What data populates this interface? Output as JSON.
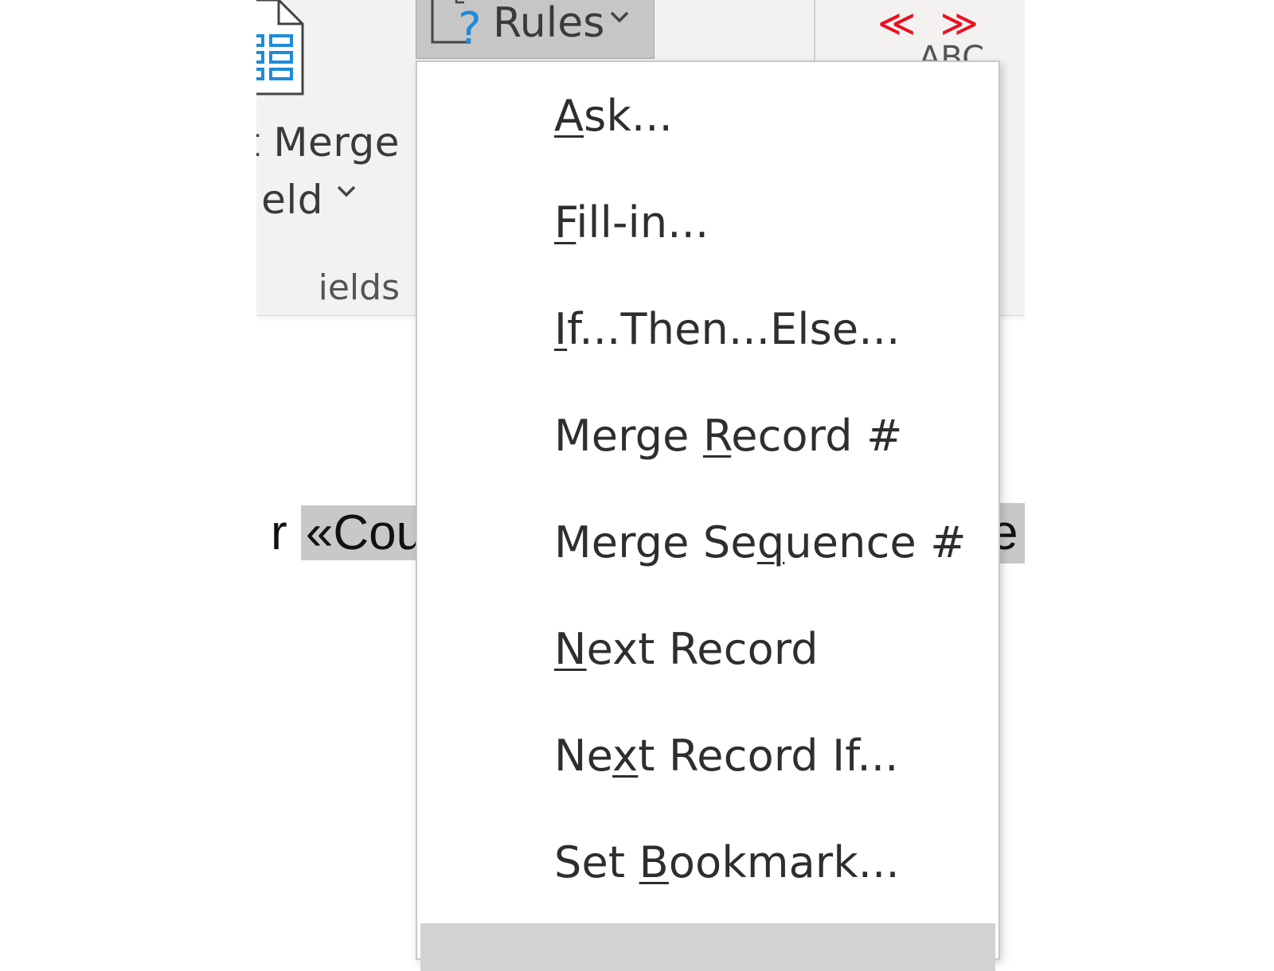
{
  "ribbon": {
    "insert_merge_field": {
      "line1": "t Merge",
      "line2": "eld"
    },
    "group_label": "ields",
    "rules_button": {
      "label": "Rules"
    },
    "preview_results": {
      "chevrons": "≪ ≫",
      "abc": "ABC"
    }
  },
  "document": {
    "prefix": "r ",
    "merge_field_visible": "«Cour",
    "tail_visible": "e"
  },
  "rules_menu": {
    "items": [
      {
        "pre": "",
        "key": "A",
        "post": "sk..."
      },
      {
        "pre": "",
        "key": "F",
        "post": "ill-in..."
      },
      {
        "pre": "",
        "key": "I",
        "post": "f...Then...Else..."
      },
      {
        "pre": "Merge ",
        "key": "R",
        "post": "ecord #"
      },
      {
        "pre": "Merge Se",
        "key": "q",
        "post": "uence #"
      },
      {
        "pre": "",
        "key": "N",
        "post": "ext Record"
      },
      {
        "pre": "Ne",
        "key": "x",
        "post": "t Record If..."
      },
      {
        "pre": "Set ",
        "key": "B",
        "post": "ookmark..."
      }
    ]
  },
  "colors": {
    "ribbon_bg": "#f3f2f1",
    "rules_button_active": "#c6c6c6",
    "field_shading": "#c8c8c8",
    "icon_blue": "#1e8bd8",
    "preview_red": "#e81123"
  }
}
